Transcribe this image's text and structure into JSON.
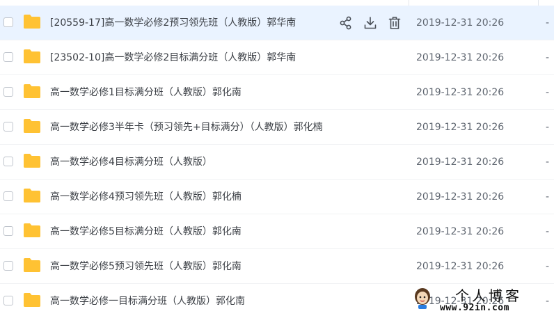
{
  "files": [
    {
      "name": "[20559-17]高一数学必修2预习领先班（人教版）郭华南",
      "modified": "2019-12-31 20:26",
      "size": "-",
      "hovered": true
    },
    {
      "name": "[23502-10]高一数学必修2目标满分班（人教版）郭华南",
      "modified": "2019-12-31 20:26",
      "size": "-"
    },
    {
      "name": "高一数学必修1目标满分班（人教版）郭化南",
      "modified": "2019-12-31 20:26",
      "size": "-"
    },
    {
      "name": "高一数学必修3半年卡（预习领先+目标满分）（人教版）郭化楠",
      "modified": "2019-12-31 20:26",
      "size": "-"
    },
    {
      "name": "高一数学必修4目标满分班（人教版）",
      "modified": "2019-12-31 20:26",
      "size": "-"
    },
    {
      "name": "高一数学必修4预习领先班（人教版）郭化楠",
      "modified": "2019-12-31 20:26",
      "size": "-"
    },
    {
      "name": "高一数学必修5目标满分班（人教版）郭化南",
      "modified": "2019-12-31 20:26",
      "size": "-"
    },
    {
      "name": "高一数学必修5预习领先班（人教版）郭化南",
      "modified": "2019-12-31 20:26",
      "size": "-"
    },
    {
      "name": "高一数学必修一目标满分班（人教版）郭化南",
      "modified": "2019-12-31 20:26",
      "size": "-"
    }
  ],
  "row_actions": {
    "icons": [
      "share-icon",
      "download-icon",
      "delete-icon"
    ]
  },
  "watermark": {
    "title": "个人博客",
    "url": "www.92in.com"
  },
  "colors": {
    "folder": "#ffc233",
    "hover_row": "#eaf3ff",
    "text": "#3b3f45",
    "muted": "#5f6670"
  }
}
